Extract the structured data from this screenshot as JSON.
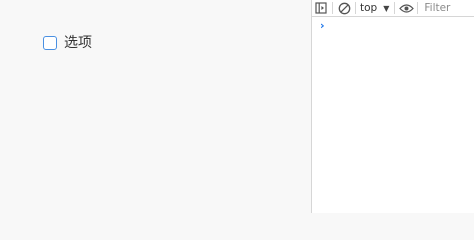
{
  "app": {
    "checkbox": {
      "label": "选项",
      "checked": false,
      "border_color": "#4a90e2"
    }
  },
  "devtools": {
    "toolbar": {
      "icons": [
        "sidebar-toggle-icon",
        "clear-console-icon",
        "chevron-down-icon",
        "eye-icon"
      ],
      "context": "top",
      "filter_placeholder": "Filter"
    },
    "console": {
      "prompt_symbol": "›",
      "prompt_color": "#1a73e8"
    }
  }
}
